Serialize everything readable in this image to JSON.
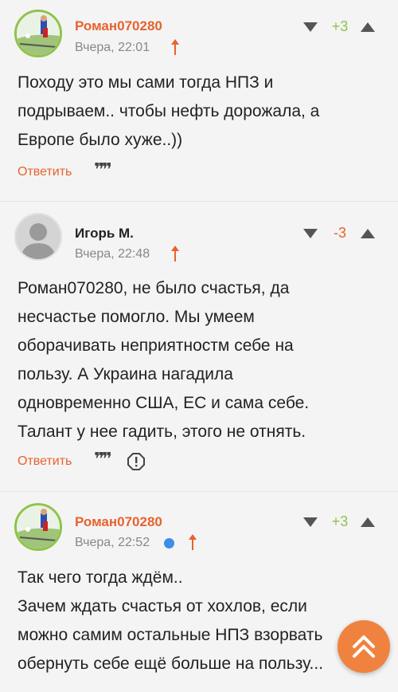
{
  "comments": [
    {
      "author": "Роман070280",
      "time": "Вчера, 22:01",
      "score": "+3",
      "text_lines": [
        "Походу это мы сами тогда НПЗ и",
        "подрываем.. чтобы нефть дорожала, а",
        "Европе было хуже..))"
      ],
      "reply_label": "Ответить"
    },
    {
      "author": "Игорь М.",
      "time": "Вчера, 22:48",
      "score": "-3",
      "text_lines": [
        "Роман070280, не было счастья, да",
        "несчастье помогло. Мы умеем",
        "оборачивать неприятностм себе на",
        "пользу. А Украина нагадила",
        "одновременно США, ЕС и сама себе.",
        "Талант у нее гадить, этого не отнять."
      ],
      "reply_label": "Ответить"
    },
    {
      "author": "Роман070280",
      "time": "Вчера, 22:52",
      "score": "+3",
      "text_lines": [
        "Так чего тогда ждём..",
        "Зачем ждать счастья от хохлов, если",
        "можно самим остальные НПЗ взорвать",
        "обернуть себе ещё больше на пользу..."
      ]
    }
  ],
  "colors": {
    "author_link": "#e8622e",
    "score_positive": "#8fc34a",
    "score_negative": "#e8622e",
    "accent": "#f0823f",
    "online": "#3d8ee8"
  },
  "icons": {
    "reply_quote": "quote-icon",
    "report": "exclamation-octagon-icon",
    "scroll_top": "double-chevron-up-icon"
  }
}
